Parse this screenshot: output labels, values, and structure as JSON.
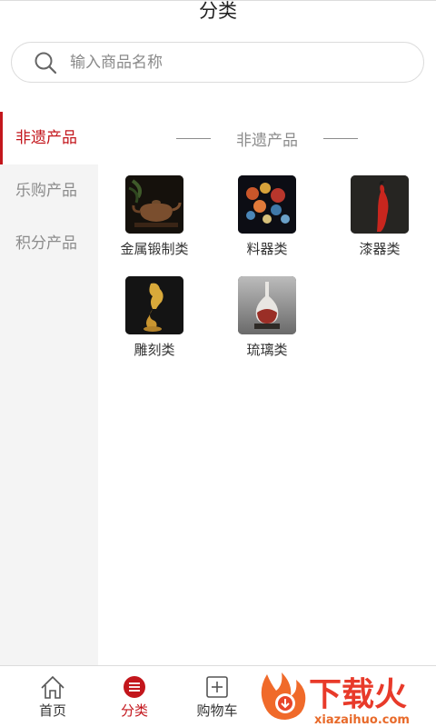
{
  "header": {
    "title": "分类"
  },
  "search": {
    "placeholder": "输入商品名称",
    "value": ""
  },
  "sidebar": {
    "items": [
      {
        "label": "非遗产品",
        "active": true
      },
      {
        "label": "乐购产品",
        "active": false
      },
      {
        "label": "积分产品",
        "active": false
      }
    ]
  },
  "section": {
    "title": "非遗产品",
    "categories": [
      {
        "label": "金属锻制类",
        "icon": "teapot-image"
      },
      {
        "label": "料器类",
        "icon": "glass-flowers-image"
      },
      {
        "label": "漆器类",
        "icon": "red-vase-image"
      },
      {
        "label": "雕刻类",
        "icon": "bird-carving-image"
      },
      {
        "label": "琉璃类",
        "icon": "glaze-vase-image"
      }
    ]
  },
  "tabbar": {
    "tabs": [
      {
        "label": "首页",
        "icon": "home-icon",
        "active": false
      },
      {
        "label": "分类",
        "icon": "category-icon",
        "active": true
      },
      {
        "label": "购物车",
        "icon": "cart-icon",
        "active": false
      }
    ]
  },
  "watermark": {
    "text": "下载火",
    "domain": "xiazaihuo.com"
  },
  "colors": {
    "accent": "#c3161c",
    "sidebar_bg": "#f4f4f4",
    "muted": "#8c8c8c"
  }
}
